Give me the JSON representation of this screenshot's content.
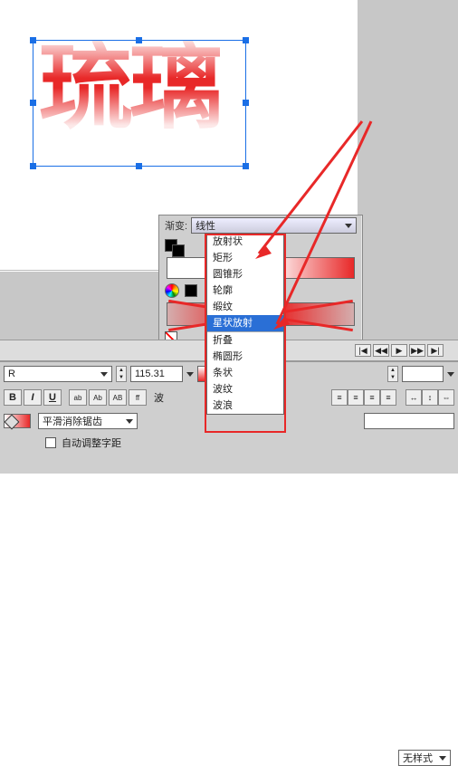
{
  "canvas": {
    "text": "琉璃"
  },
  "panel": {
    "grad_label": "渐变:",
    "dropdown_value": "线性"
  },
  "menu": {
    "items": [
      "放射状",
      "矩形",
      "圆锥形",
      "轮廓",
      "缎纹",
      "星状放射",
      "折叠",
      "椭圆形",
      "条状",
      "波纹",
      "波浪"
    ],
    "selected_index": 5
  },
  "timeline": {
    "buttons": [
      "|◀",
      "◀◀",
      "▶",
      "▶▶",
      "▶|"
    ]
  },
  "propbar": {
    "font_family": "R",
    "font_size": "115.31",
    "bold": "B",
    "italic": "I",
    "underline": "U",
    "btn_labels": [
      "ab",
      "Ab",
      "AB",
      "ff"
    ],
    "bottom_label": "波",
    "smooth_label": "平滑消除锯齿",
    "auto_kern_label": "自动调整字距",
    "no_style_label": "无样式"
  },
  "colors": {
    "red": "#e82828",
    "blue": "#1a6fe6"
  }
}
